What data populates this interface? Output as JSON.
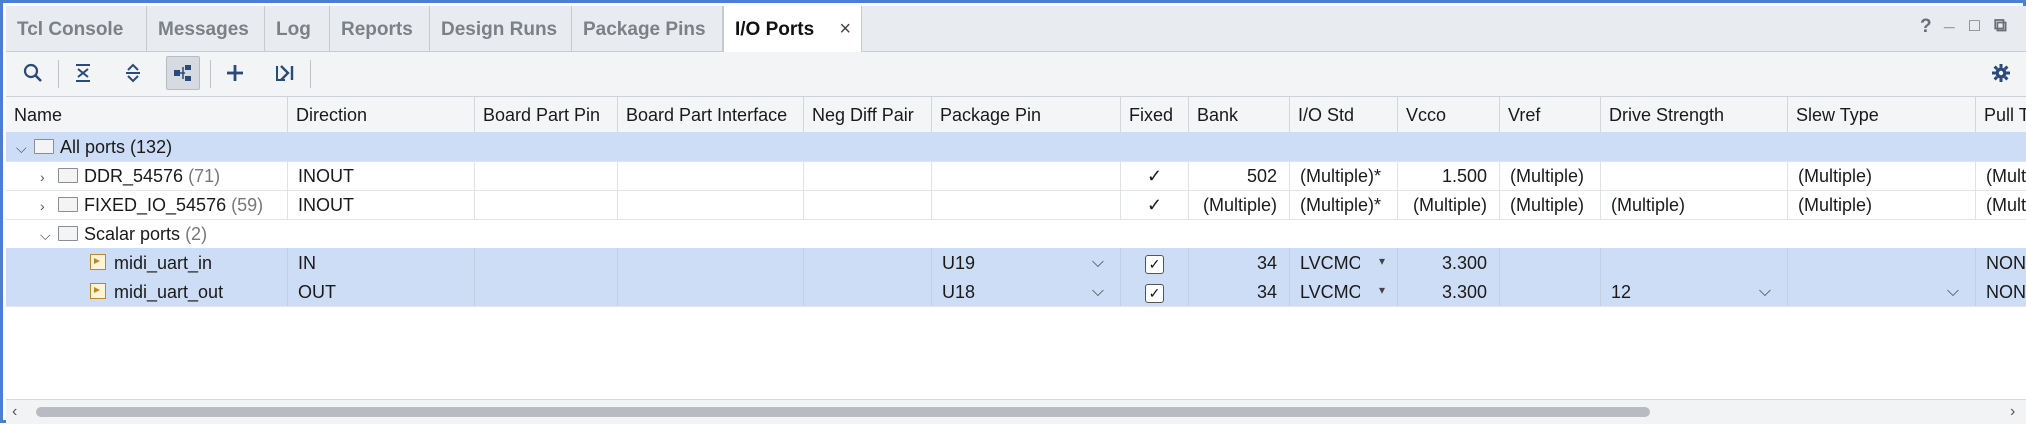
{
  "tabs": [
    {
      "label": "Tcl Console"
    },
    {
      "label": "Messages"
    },
    {
      "label": "Log"
    },
    {
      "label": "Reports"
    },
    {
      "label": "Design Runs"
    },
    {
      "label": "Package Pins"
    },
    {
      "label": "I/O Ports",
      "active": true
    }
  ],
  "window_controls": {
    "help": "?",
    "minimize": "_",
    "maximize": "□",
    "float": "⧉",
    "close": "×"
  },
  "toolbar": {
    "icons": [
      "search-icon",
      "collapse-all-icon",
      "expand-all-icon",
      "group-by-interface-icon",
      "add-icon",
      "export-icon",
      "settings-icon"
    ]
  },
  "columns": [
    "Name",
    "Direction",
    "Board Part Pin",
    "Board Part Interface",
    "Neg Diff Pair",
    "Package Pin",
    "Fixed",
    "Bank",
    "I/O Std",
    "Vcco",
    "Vref",
    "Drive Strength",
    "Slew Type",
    "Pull T"
  ],
  "rows": [
    {
      "name": "All ports",
      "count": "(132)"
    },
    {
      "name": "DDR_54576",
      "count": "(71)",
      "direction": "INOUT",
      "fixed": "✓",
      "bank": "502",
      "iostd": "(Multiple)*",
      "vcco": "1.500",
      "vref": "(Multiple)",
      "slew": "(Multiple)",
      "pull": "(Mult"
    },
    {
      "name": "FIXED_IO_54576",
      "count": "(59)",
      "direction": "INOUT",
      "fixed": "✓",
      "bank": "(Multiple)",
      "iostd": "(Multiple)*",
      "vcco": "(Multiple)",
      "vref": "(Multiple)",
      "drive": "(Multiple)",
      "slew": "(Multiple)",
      "pull": "(Mult"
    },
    {
      "name": "Scalar ports",
      "count": "(2)"
    },
    {
      "name": "midi_uart_in",
      "direction": "IN",
      "pin": "U19",
      "fixed": "✓",
      "bank": "34",
      "iostd": "LVCMOS",
      "vcco": "3.300",
      "pull": "NON"
    },
    {
      "name": "midi_uart_out",
      "direction": "OUT",
      "pin": "U18",
      "fixed": "✓",
      "bank": "34",
      "iostd": "LVCMOS",
      "vcco": "3.300",
      "drive": "12",
      "pull": "NON"
    }
  ],
  "colors": {
    "accent": "#4a7fd2",
    "selection": "#cdddf5",
    "icon": "#2a4a7a"
  }
}
